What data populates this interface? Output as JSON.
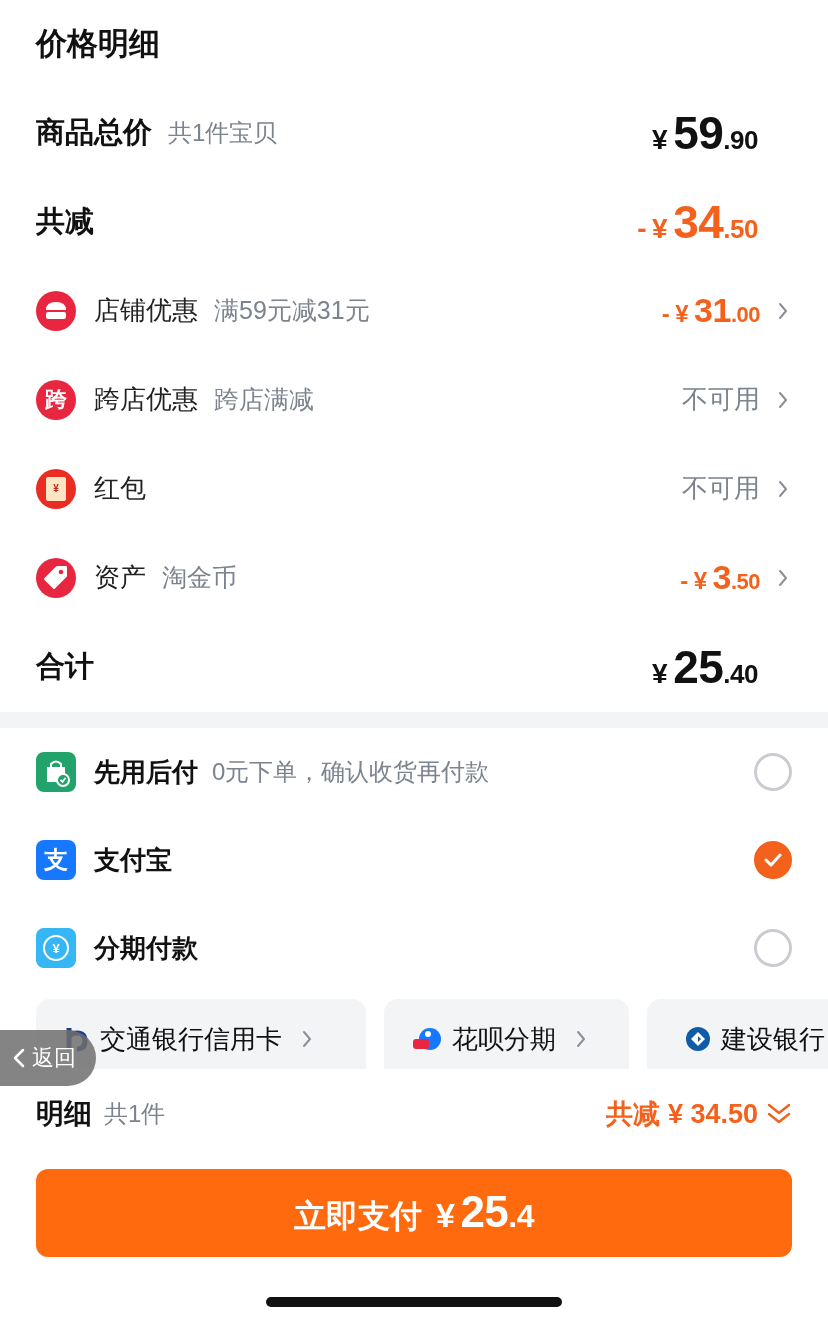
{
  "title": "价格明细",
  "subtotal": {
    "label": "商品总价",
    "note": "共1件宝贝",
    "currency": "¥",
    "integer": "59",
    "decimal": ".90"
  },
  "total_discount": {
    "label": "共减",
    "sign": "-",
    "currency": "¥",
    "integer": "34",
    "decimal": ".50"
  },
  "discounts": [
    {
      "kind": "store",
      "label": "店铺优惠",
      "note": "满59元减31元",
      "value": {
        "kind": "amount",
        "sign": "-",
        "currency": "¥",
        "integer": "31",
        "decimal": ".00"
      }
    },
    {
      "kind": "cross",
      "icon_text": "跨",
      "label": "跨店优惠",
      "note": "跨店满减",
      "value": {
        "kind": "status",
        "text": "不可用"
      }
    },
    {
      "kind": "redpacket",
      "icon_text": "¥",
      "label": "红包",
      "value": {
        "kind": "status",
        "text": "不可用"
      }
    },
    {
      "kind": "asset",
      "label": "资产",
      "note": "淘金币",
      "value": {
        "kind": "amount",
        "sign": "-",
        "currency": "¥",
        "integer": "3",
        "decimal": ".50"
      }
    }
  ],
  "grand_total": {
    "label": "合计",
    "currency": "¥",
    "integer": "25",
    "decimal": ".40"
  },
  "payments": [
    {
      "kind": "later",
      "label": "先用后付",
      "note": "0元下单，确认收货再付款",
      "selected": false
    },
    {
      "kind": "alipay",
      "icon_text": "支",
      "label": "支付宝",
      "selected": true
    },
    {
      "kind": "installment",
      "icon_text": "¥",
      "label": "分期付款",
      "selected": false
    }
  ],
  "installment_options": [
    {
      "kind": "bocom",
      "label": "交通银行信用卡"
    },
    {
      "kind": "huabei",
      "label": "花呗分期"
    },
    {
      "kind": "ccb",
      "label": "建设银行"
    }
  ],
  "back_overlay": {
    "label": "返回"
  },
  "footer": {
    "label": "明细",
    "count": "共1件",
    "savings": "共减 ¥ 34.50"
  },
  "pay_button": {
    "label": "立即支付",
    "currency": "¥",
    "integer": "25",
    "decimal": ".4"
  }
}
